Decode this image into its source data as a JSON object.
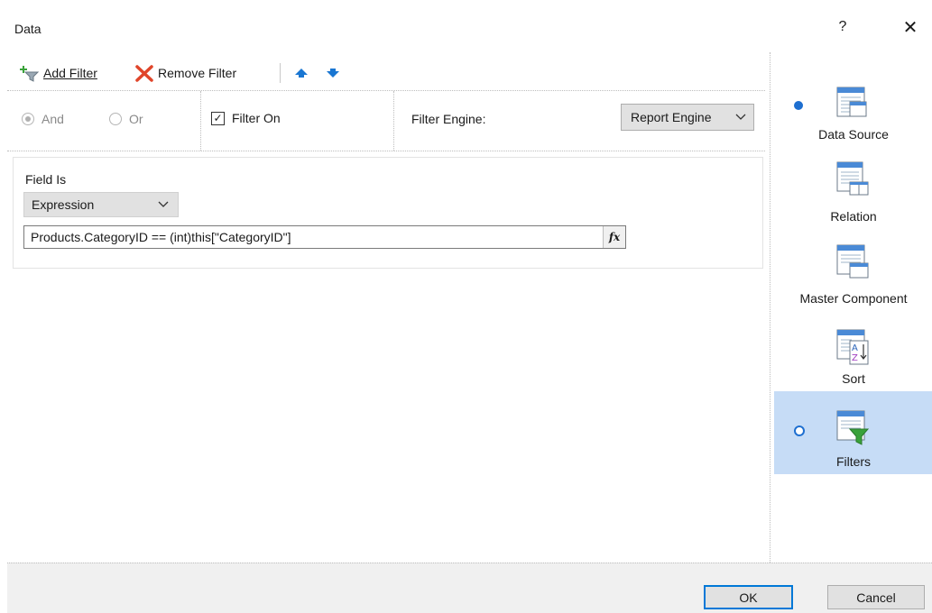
{
  "dialog": {
    "title": "Data",
    "help_label": "?",
    "close_label": "✕"
  },
  "toolbar": {
    "add_filter": "Add Filter",
    "remove_filter": "Remove Filter"
  },
  "options": {
    "and_label": "And",
    "or_label": "Or",
    "and_selected": true,
    "or_selected": false,
    "filter_on_label": "Filter On",
    "filter_on_checked": true,
    "filter_engine_label": "Filter Engine:",
    "filter_engine_value": "Report Engine"
  },
  "filter": {
    "field_label": "Field Is",
    "field_type": "Expression",
    "expression": "Products.CategoryID == (int)this[\"CategoryID\"]",
    "fx_label": "fx"
  },
  "nav": {
    "items": [
      {
        "label": "Data Source",
        "icon": "data-source-icon",
        "has_bullet": true
      },
      {
        "label": "Relation",
        "icon": "relation-icon",
        "has_bullet": false
      },
      {
        "label": "Master Component",
        "icon": "master-component-icon",
        "has_bullet": false
      },
      {
        "label": "Sort",
        "icon": "sort-icon",
        "has_bullet": false
      },
      {
        "label": "Filters",
        "icon": "filters-icon",
        "has_bullet": true,
        "selected": true
      }
    ]
  },
  "buttons": {
    "ok": "OK",
    "cancel": "Cancel"
  },
  "colors": {
    "accent": "#0078d7",
    "selected_bg": "#c6dcf6",
    "bullet": "#1e6fd0"
  }
}
